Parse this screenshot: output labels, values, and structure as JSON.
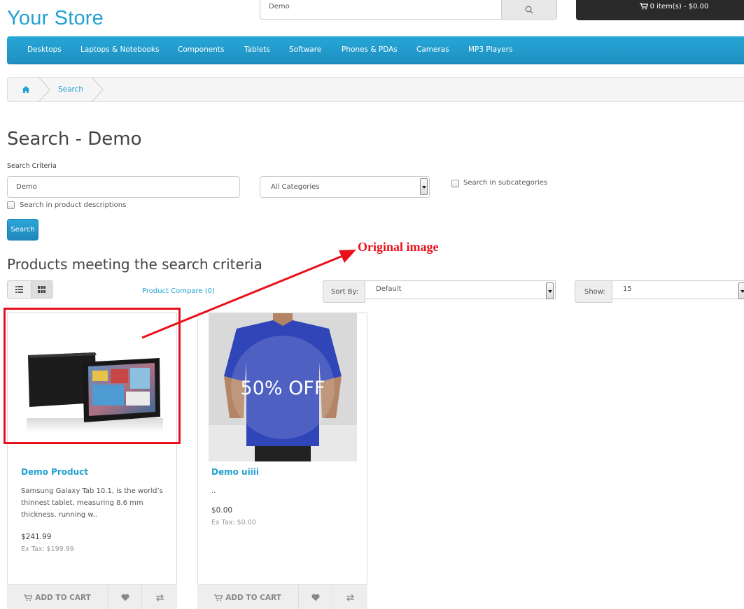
{
  "header": {
    "store_name": "Your Store",
    "search_value": "Demo",
    "cart_label": "0 item(s) - $0.00"
  },
  "menu": {
    "items": [
      "Desktops",
      "Laptops & Notebooks",
      "Components",
      "Tablets",
      "Software",
      "Phones & PDAs",
      "Cameras",
      "MP3 Players"
    ]
  },
  "breadcrumb": {
    "current": "Search"
  },
  "page": {
    "title": "Search - Demo",
    "criteria_label": "Search Criteria",
    "search_input_value": "Demo",
    "category_selected": "All Categories",
    "subcategories_label": "Search in subcategories",
    "descriptions_label": "Search in product descriptions",
    "search_button": "Search",
    "products_heading": "Products meeting the search criteria"
  },
  "annotation": {
    "text": "Original image",
    "color": "#e8111b"
  },
  "toolbar": {
    "compare_link": "Product Compare (0)",
    "sort_label": "Sort By:",
    "sort_value": "Default",
    "show_label": "Show:",
    "show_value": "15"
  },
  "products": [
    {
      "name": "Demo Product",
      "description": "Samsung Galaxy Tab 10.1, is the world’s thinnest tablet, measuring 8.6 mm thickness, running w..",
      "price": "$241.99",
      "ex_tax": "Ex Tax: $199.99",
      "add_to_cart": "ADD TO CART"
    },
    {
      "name": "Demo uiiii",
      "description": "..",
      "price": "$0.00",
      "ex_tax": "Ex Tax: $0.00",
      "add_to_cart": "ADD TO CART",
      "badge": "50% OFF"
    }
  ],
  "colors": {
    "accent": "#23a1d1",
    "menu_bg": "#229dd0",
    "cart_bg": "#2a2a2a"
  }
}
